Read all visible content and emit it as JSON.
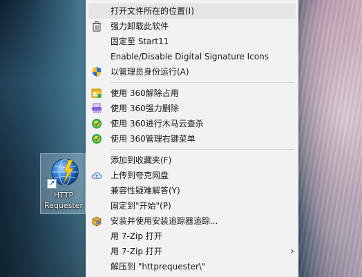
{
  "desktop": {
    "icon": {
      "label": "HTTP\nRequester"
    }
  },
  "context_menu": {
    "groups": [
      [
        {
          "label": "打开文件所在的位置(I)",
          "icon": "none",
          "highlighted": true
        },
        {
          "label": "强力卸载此软件",
          "icon": "trash-icon"
        },
        {
          "label": "固定至 Start11",
          "icon": "none"
        },
        {
          "label": "Enable/Disable Digital Signature Icons",
          "icon": "none"
        },
        {
          "label": "以管理员身份运行(A)",
          "icon": "uac-shield-icon"
        }
      ],
      [
        {
          "label": "使用 360解除占用",
          "icon": "360-unlock-icon"
        },
        {
          "label": "使用 360强力删除",
          "icon": "360-shred-icon"
        },
        {
          "label": "使用 360进行木马云查杀",
          "icon": "360-scan-icon"
        },
        {
          "label": "使用 360管理右键菜单",
          "icon": "360-menu-icon"
        }
      ],
      [
        {
          "label": "添加到收藏夹(F)",
          "icon": "none"
        },
        {
          "label": "上传到夸克网盘",
          "icon": "quark-cloud-icon"
        },
        {
          "label": "兼容性疑难解答(Y)",
          "icon": "none"
        },
        {
          "label": "固定到\"开始\"(P)",
          "icon": "none"
        },
        {
          "label": "安装并使用安装追踪器追踪...",
          "icon": "installer-box-icon"
        },
        {
          "label": "用 7-Zip 打开",
          "icon": "none"
        },
        {
          "label": "用 7-Zip 打开",
          "icon": "none",
          "submenu": true
        },
        {
          "label": "解压到 \"httprequester\\\"",
          "icon": "none"
        }
      ]
    ],
    "submenu_arrow": "›"
  },
  "colors": {
    "menu_bg": "#f2f2f2",
    "hover_bg": "#e5e5e5",
    "separator": "#d6d6d6",
    "text": "#1a1a1a"
  }
}
